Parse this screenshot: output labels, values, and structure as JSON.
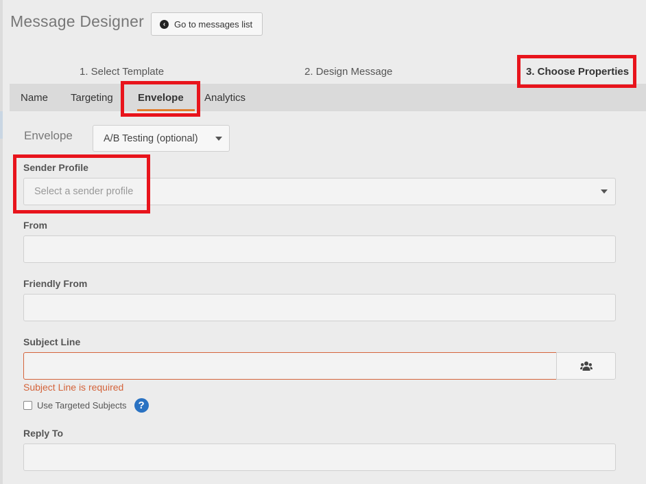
{
  "header": {
    "title": "Message Designer",
    "back_label": "Go to messages list"
  },
  "steps": [
    {
      "label": "1. Select Template"
    },
    {
      "label": "2. Design Message"
    },
    {
      "label": "3. Choose Properties"
    }
  ],
  "tabs": [
    {
      "label": "Name"
    },
    {
      "label": "Targeting"
    },
    {
      "label": "Envelope"
    },
    {
      "label": "Analytics"
    }
  ],
  "active_tab": "Envelope",
  "envelope": {
    "label": "Envelope",
    "selected": "A/B Testing (optional)"
  },
  "form": {
    "sender_profile": {
      "label": "Sender Profile",
      "placeholder": "Select a sender profile"
    },
    "from": {
      "label": "From",
      "value": ""
    },
    "friendly_from": {
      "label": "Friendly From",
      "value": ""
    },
    "subject_line": {
      "label": "Subject Line",
      "value": "",
      "error": "Subject Line is required"
    },
    "use_targeted_subjects": {
      "label": "Use Targeted Subjects",
      "checked": false
    },
    "reply_to": {
      "label": "Reply To",
      "value": ""
    }
  },
  "colors": {
    "accent_underline": "#e07b2a",
    "error": "#d4633a",
    "highlight": "#e8141c",
    "help": "#2a72c2"
  },
  "icons": [
    "arrow-circle-left-icon",
    "users-icon",
    "question-circle-icon",
    "caret-down-icon"
  ]
}
